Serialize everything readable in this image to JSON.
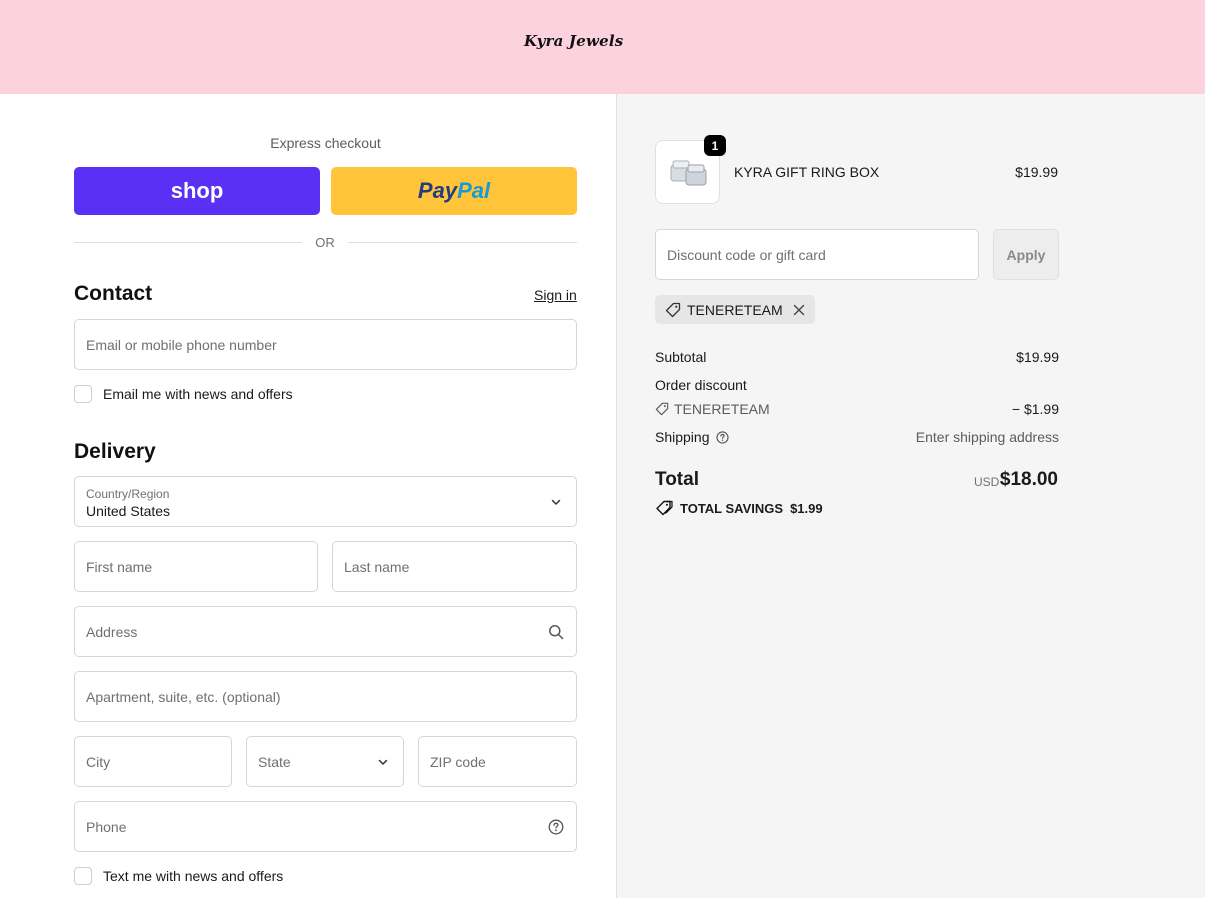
{
  "header": {
    "store_name": "Kyra Jewels",
    "bg_color": "#fcd2de"
  },
  "checkout": {
    "express_label": "Express checkout",
    "shop_label": "shop",
    "paypal_label_1": "Pay",
    "paypal_label_2": "Pal",
    "or_label": "OR",
    "contact": {
      "title": "Contact",
      "sign_in": "Sign in",
      "email_placeholder": "Email or mobile phone number",
      "news_checkbox_label": "Email me with news and offers"
    },
    "delivery": {
      "title": "Delivery",
      "country_label": "Country/Region",
      "country_value": "United States",
      "first_name_placeholder": "First name",
      "last_name_placeholder": "Last name",
      "address_placeholder": "Address",
      "apartment_placeholder": "Apartment, suite, etc. (optional)",
      "city_placeholder": "City",
      "state_placeholder": "State",
      "zip_placeholder": "ZIP code",
      "phone_placeholder": "Phone",
      "sms_checkbox_label": "Text me with news and offers"
    }
  },
  "summary": {
    "item": {
      "name": "KYRA GIFT RING BOX",
      "price": "$19.99",
      "quantity": "1"
    },
    "discount_placeholder": "Discount code or gift card",
    "apply_label": "Apply",
    "applied_code": "TENERETEAM",
    "subtotal_label": "Subtotal",
    "subtotal_value": "$19.99",
    "order_discount_label": "Order discount",
    "discount_code": "TENERETEAM",
    "discount_value": "− $1.99",
    "shipping_label": "Shipping",
    "shipping_value": "Enter shipping address",
    "total_label": "Total",
    "total_currency": "USD",
    "total_value": "$18.00",
    "savings_label": "TOTAL SAVINGS",
    "savings_value": "$1.99"
  }
}
